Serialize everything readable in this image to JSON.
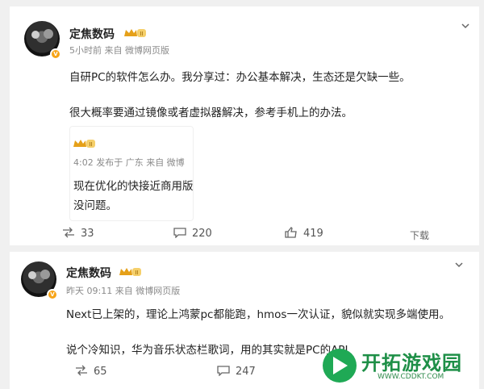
{
  "post1": {
    "author": "定焦数码",
    "meta": "5小时前  来自  微博网页版",
    "line1": "自研PC的软件怎么办。我分享过：办公基本解决，生态还是欠缺一些。",
    "line2": "很大概率要通过镜像或者虚拟器解决，参考手机上的办法。",
    "quote": {
      "meta": "4:02  发布于 广东  来自  微博",
      "line1": "现在优化的快接近商用版",
      "line2": "没问题。"
    },
    "actions": {
      "repost": "33",
      "comment": "220",
      "like": "419",
      "download": "下载"
    }
  },
  "post2": {
    "author": "定焦数码",
    "meta": "昨天 09:11  来自  微博网页版",
    "line1": "Next已上架的，理论上鸿蒙pc都能跑，hmos一次认证，貌似就实现多端使用。",
    "line2": "说个冷知识，华为音乐状态栏歌词，用的其实就是PC的API",
    "actions": {
      "repost": "65",
      "comment": "247"
    }
  },
  "watermark": {
    "title": "开拓游戏园",
    "url": "WWW.CDDKT.COM"
  },
  "colors": {
    "badge": "#f7a417",
    "watermark_green": "#1fa955"
  }
}
